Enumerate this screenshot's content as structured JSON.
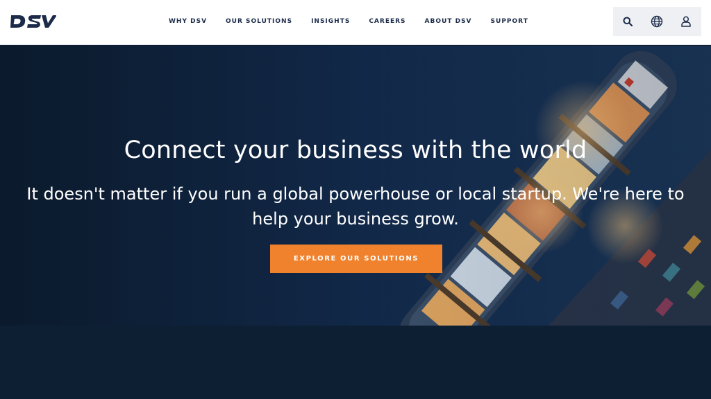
{
  "header": {
    "logo_text": "DSV",
    "nav": [
      "WHY DSV",
      "OUR SOLUTIONS",
      "INSIGHTS",
      "CAREERS",
      "ABOUT DSV",
      "SUPPORT"
    ],
    "tools": [
      "search-icon",
      "globe-icon",
      "user-icon"
    ]
  },
  "hero": {
    "title": "Connect your business with the world",
    "subtitle": "It doesn't matter if you run a global powerhouse or local startup. We're here to help your business grow.",
    "cta_label": "EXPLORE OUR SOLUTIONS"
  },
  "colors": {
    "brand_navy": "#1b2b49",
    "cta_orange": "#f0822d",
    "hero_bg": "#0c1c30",
    "page_bg": "#0d1f33"
  }
}
